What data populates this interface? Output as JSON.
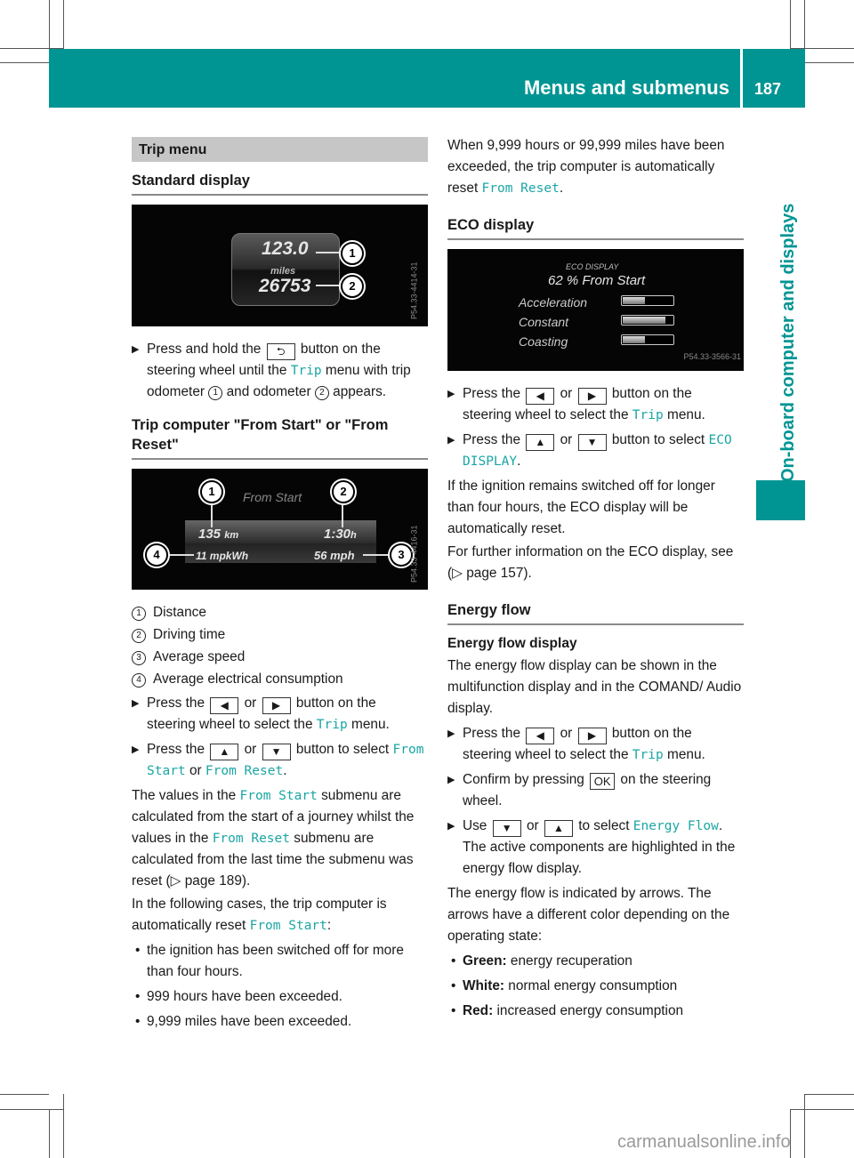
{
  "header": {
    "title": "Menus and submenus",
    "page_number": "187",
    "side_tab": "On-board computer and displays",
    "accent_color": "#009593",
    "link_color": "#1aa6a4"
  },
  "left": {
    "section_title": "Trip menu",
    "standard_display": {
      "heading": "Standard display",
      "figure": {
        "trip_value": "123.0",
        "unit": "miles",
        "odometer_value": "26753",
        "callouts": [
          "1",
          "2"
        ],
        "code": "P54.33-4414-31"
      },
      "step": {
        "pre": "Press and hold the",
        "key": "⮌",
        "mid1": "button on the steering wheel until the",
        "link": "Trip",
        "mid2": "menu with trip odometer",
        "c1": "1",
        "mid3": "and odometer",
        "c2": "2",
        "post": "appears."
      }
    },
    "trip_computer": {
      "heading": "Trip computer \"From Start\" or \"From Reset\"",
      "figure": {
        "title": "From Start",
        "distance": "135",
        "distance_unit": "km",
        "time": "1:30",
        "time_unit": "h",
        "consumption": "11 mpkWh",
        "speed": "56 mph",
        "callouts": [
          "1",
          "2",
          "3",
          "4"
        ],
        "code": "P54.33-4416-31"
      },
      "legend": [
        {
          "num": "1",
          "label": "Distance"
        },
        {
          "num": "2",
          "label": "Driving time"
        },
        {
          "num": "3",
          "label": "Average speed"
        },
        {
          "num": "4",
          "label": "Average electrical consumption"
        }
      ],
      "step1": {
        "pre": "Press the",
        "key1": "◀",
        "or": "or",
        "key2": "▶",
        "mid": "button on the steering wheel to select the",
        "link": "Trip",
        "post": "menu."
      },
      "step2": {
        "pre": "Press the",
        "key1": "▲",
        "or": "or",
        "key2": "▼",
        "mid": "button to select",
        "link1": "From Start",
        "or2": "or",
        "link2": "From Reset",
        "post": "."
      },
      "para1": {
        "a": "The values in the",
        "link1": "From Start",
        "b": "submenu are calculated from the start of a journey whilst the values in the",
        "link2": "From Reset",
        "c": "submenu are calculated from the last time the submenu was reset (▷ page 189)."
      },
      "para2": {
        "a": "In the following cases, the trip computer is automatically reset",
        "link": "From Start",
        "b": ":"
      },
      "bullets": [
        "the ignition has been switched off for more than four hours.",
        "999 hours have been exceeded.",
        "9,999 miles have been exceeded."
      ]
    }
  },
  "right": {
    "para_reset": {
      "a": "When 9,999 hours or 99,999 miles have been exceeded, the trip computer is automatically reset",
      "link": "From Reset",
      "b": "."
    },
    "eco": {
      "heading": "ECO display",
      "figure": {
        "title": "ECO DISPLAY",
        "subtitle": "62 % From Start",
        "rows": [
          {
            "label": "Acceleration",
            "level": 0.45
          },
          {
            "label": "Constant",
            "level": 0.85
          },
          {
            "label": "Coasting",
            "level": 0.45
          }
        ],
        "code": "P54.33-3566-31"
      },
      "step1": {
        "pre": "Press the",
        "key1": "◀",
        "or": "or",
        "key2": "▶",
        "mid": "button on the steering wheel to select the",
        "link": "Trip",
        "post": "menu."
      },
      "step2": {
        "pre": "Press the",
        "key1": "▲",
        "or": "or",
        "key2": "▼",
        "mid": "button to select",
        "link": "ECO DISPLAY",
        "post": "."
      },
      "para1": "If the ignition remains switched off for longer than four hours, the ECO display will be automatically reset.",
      "para2": "For further information on the ECO display, see (▷ page 157)."
    },
    "energy": {
      "heading": "Energy flow",
      "subheading": "Energy flow display",
      "para1": "The energy flow display can be shown in the multifunction display and in the COMAND/ Audio display.",
      "step1": {
        "pre": "Press the",
        "key1": "◀",
        "or": "or",
        "key2": "▶",
        "mid": "button on the steering wheel to select the",
        "link": "Trip",
        "post": "menu."
      },
      "step2": {
        "pre": "Confirm by pressing",
        "key": "OK",
        "post": "on the steering wheel."
      },
      "step3": {
        "pre": "Use",
        "key1": "▼",
        "or": "or",
        "key2": "▲",
        "mid": "to select",
        "link": "Energy Flow",
        "post": ". The active components are highlighted in the energy flow display."
      },
      "para2": "The energy flow is indicated by arrows. The arrows have a different color depending on the operating state:",
      "bullets": [
        {
          "label": "Green:",
          "text": "energy recuperation"
        },
        {
          "label": "White:",
          "text": "normal energy consumption"
        },
        {
          "label": "Red:",
          "text": "increased energy consumption"
        }
      ]
    }
  },
  "footer": {
    "watermark": "carmanualsonline.info"
  }
}
